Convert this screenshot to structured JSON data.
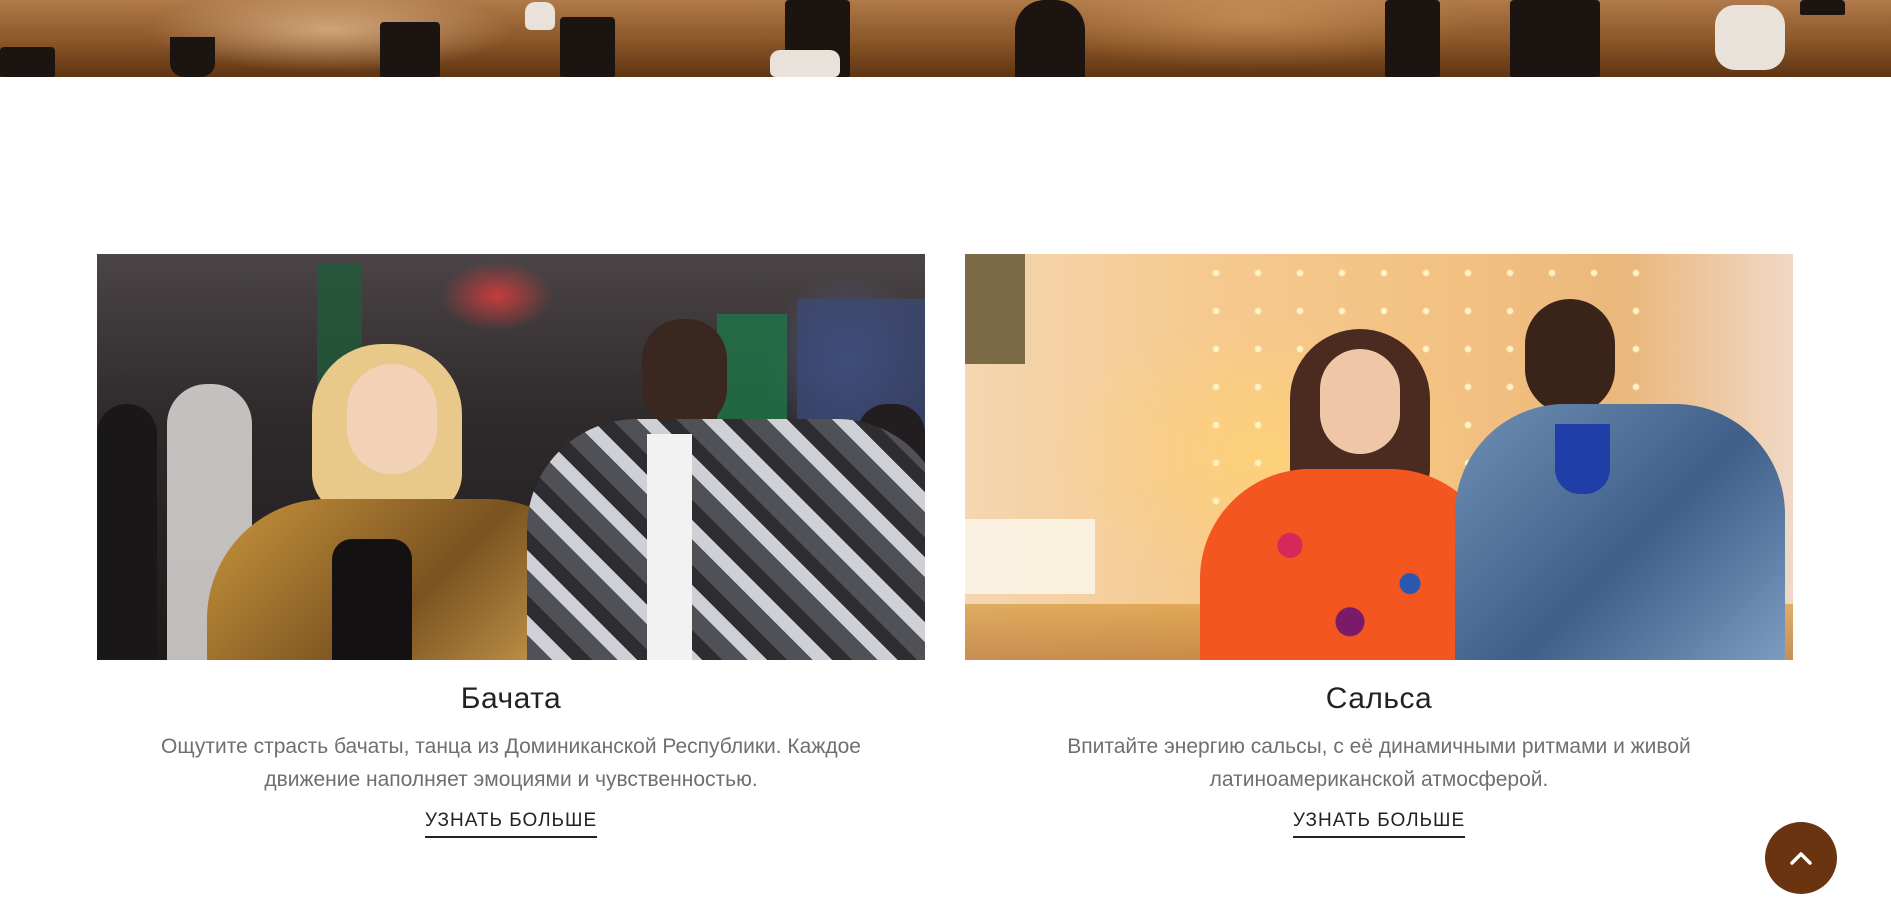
{
  "cards": [
    {
      "title": "Бачата",
      "description": "Ощутите страсть бачаты, танца из Доминиканской Республики. Каждое движение наполняет эмоциями и чувственностью.",
      "link_label": "УЗНАТЬ БОЛЬШЕ"
    },
    {
      "title": "Сальса",
      "description": "Впитайте энергию сальсы, с её динамичными ритмами и живой латиноамериканской атмосферой.",
      "link_label": "УЗНАТЬ БОЛЬШЕ"
    }
  ],
  "scroll_top": {
    "icon": "chevron-up-icon"
  },
  "colors": {
    "accent_brown": "#6b3410",
    "title_text": "#222222",
    "body_text": "#6f6f6f",
    "background": "#ffffff"
  }
}
